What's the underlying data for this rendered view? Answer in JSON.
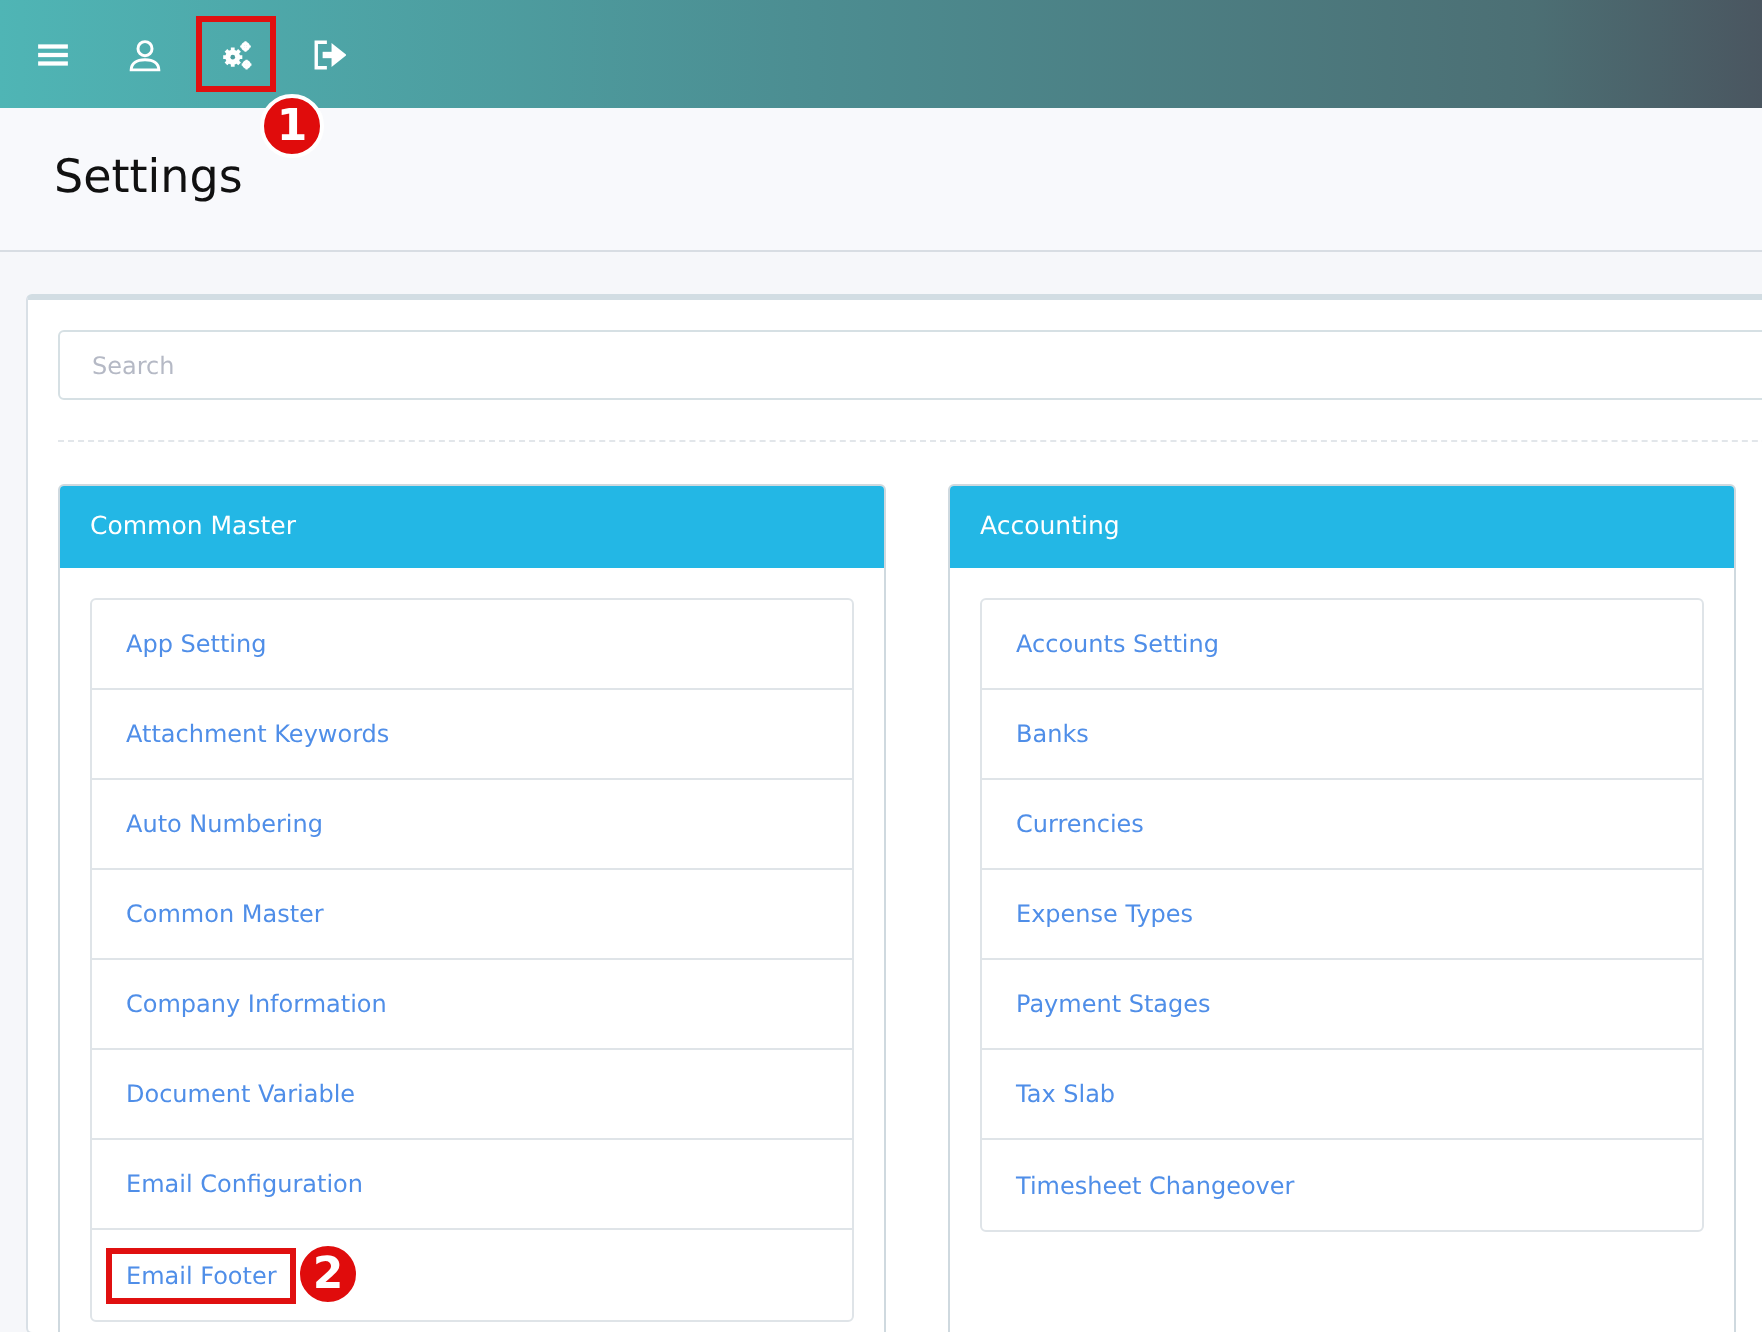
{
  "top_bar": {
    "icons": [
      {
        "kind": "menu",
        "highlighted": false
      },
      {
        "kind": "user",
        "highlighted": false
      },
      {
        "kind": "settings",
        "highlighted": true
      },
      {
        "kind": "logout",
        "highlighted": false
      }
    ]
  },
  "page_title": "Settings",
  "search": {
    "placeholder": "Search"
  },
  "panels": [
    {
      "title": "Common Master",
      "items": [
        {
          "label": "App Setting",
          "highlighted": false
        },
        {
          "label": "Attachment Keywords",
          "highlighted": false
        },
        {
          "label": "Auto Numbering",
          "highlighted": false
        },
        {
          "label": "Common Master",
          "highlighted": false
        },
        {
          "label": "Company Information",
          "highlighted": false
        },
        {
          "label": "Document Variable",
          "highlighted": false
        },
        {
          "label": "Email Configuration",
          "highlighted": false
        },
        {
          "label": "Email Footer",
          "highlighted": true
        }
      ]
    },
    {
      "title": "Accounting",
      "items": [
        {
          "label": "Accounts Setting",
          "highlighted": false
        },
        {
          "label": "Banks",
          "highlighted": false
        },
        {
          "label": "Currencies",
          "highlighted": false
        },
        {
          "label": "Expense Types",
          "highlighted": false
        },
        {
          "label": "Payment Stages",
          "highlighted": false
        },
        {
          "label": "Tax Slab",
          "highlighted": false
        },
        {
          "label": "Timesheet Changeover",
          "highlighted": false
        }
      ]
    }
  ],
  "callouts": [
    {
      "label": "1"
    },
    {
      "label": "2"
    }
  ]
}
